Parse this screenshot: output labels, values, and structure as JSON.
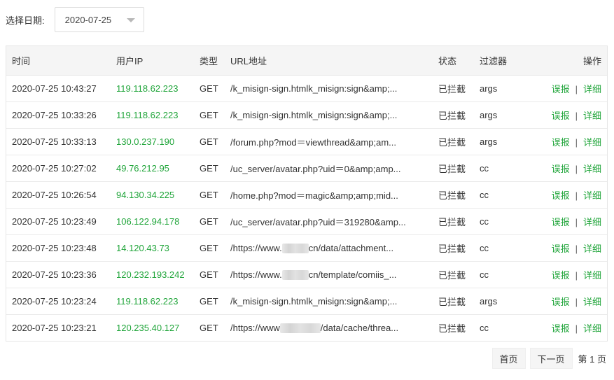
{
  "filter": {
    "label": "选择日期:",
    "date_value": "2020-07-25"
  },
  "table": {
    "headers": {
      "time": "时间",
      "ip": "用户IP",
      "type": "类型",
      "url": "URL地址",
      "status": "状态",
      "filter": "过滤器",
      "ops": "操作"
    },
    "rows": [
      {
        "time": "2020-07-25 10:43:27",
        "ip": "119.118.62.223",
        "type": "GET",
        "url_pre": "/k_misign-sign.htmlk_misign:sign&amp;...",
        "url_post": "",
        "status": "已拦截",
        "filter": "args",
        "report": "误报",
        "detail": "详细"
      },
      {
        "time": "2020-07-25 10:33:26",
        "ip": "119.118.62.223",
        "type": "GET",
        "url_pre": "/k_misign-sign.htmlk_misign:sign&amp;...",
        "url_post": "",
        "status": "已拦截",
        "filter": "args",
        "report": "误报",
        "detail": "详细"
      },
      {
        "time": "2020-07-25 10:33:13",
        "ip": "130.0.237.190",
        "type": "GET",
        "url_pre": "/forum.php?mod＝viewthread&amp;am...",
        "url_post": "",
        "status": "已拦截",
        "filter": "args",
        "report": "误报",
        "detail": "详细"
      },
      {
        "time": "2020-07-25 10:27:02",
        "ip": "49.76.212.95",
        "type": "GET",
        "url_pre": "/uc_server/avatar.php?uid＝0&amp;amp...",
        "url_post": "",
        "status": "已拦截",
        "filter": "cc",
        "report": "误报",
        "detail": "详细"
      },
      {
        "time": "2020-07-25 10:26:54",
        "ip": "94.130.34.225",
        "type": "GET",
        "url_pre": "/home.php?mod＝magic&amp;amp;mid...",
        "url_post": "",
        "status": "已拦截",
        "filter": "cc",
        "report": "误报",
        "detail": "详细"
      },
      {
        "time": "2020-07-25 10:23:49",
        "ip": "106.122.94.178",
        "type": "GET",
        "url_pre": "/uc_server/avatar.php?uid＝319280&amp...",
        "url_post": "",
        "status": "已拦截",
        "filter": "cc",
        "report": "误报",
        "detail": "详细"
      },
      {
        "time": "2020-07-25 10:23:48",
        "ip": "14.120.43.73",
        "type": "GET",
        "url_pre": "/https://www.",
        "url_post": "cn/data/attachment...",
        "status": "已拦截",
        "filter": "cc",
        "report": "误报",
        "detail": "详细"
      },
      {
        "time": "2020-07-25 10:23:36",
        "ip": "120.232.193.242",
        "type": "GET",
        "url_pre": "/https://www.",
        "url_post": "cn/template/comiis_...",
        "status": "已拦截",
        "filter": "cc",
        "report": "误报",
        "detail": "详细"
      },
      {
        "time": "2020-07-25 10:23:24",
        "ip": "119.118.62.223",
        "type": "GET",
        "url_pre": "/k_misign-sign.htmlk_misign:sign&amp;...",
        "url_post": "",
        "status": "已拦截",
        "filter": "args",
        "report": "误报",
        "detail": "详细"
      },
      {
        "time": "2020-07-25 10:23:21",
        "ip": "120.235.40.127",
        "type": "GET",
        "url_pre": "/https://www",
        "url_post": "/data/cache/threa...",
        "status": "已拦截",
        "filter": "cc",
        "report": "误报",
        "detail": "详细"
      }
    ]
  },
  "pagination": {
    "first": "首页",
    "next": "下一页",
    "info": "第 1 页"
  },
  "colors": {
    "accent": "#20a53a",
    "header_bg": "#f5f5f5",
    "border": "#e6e6e6"
  }
}
